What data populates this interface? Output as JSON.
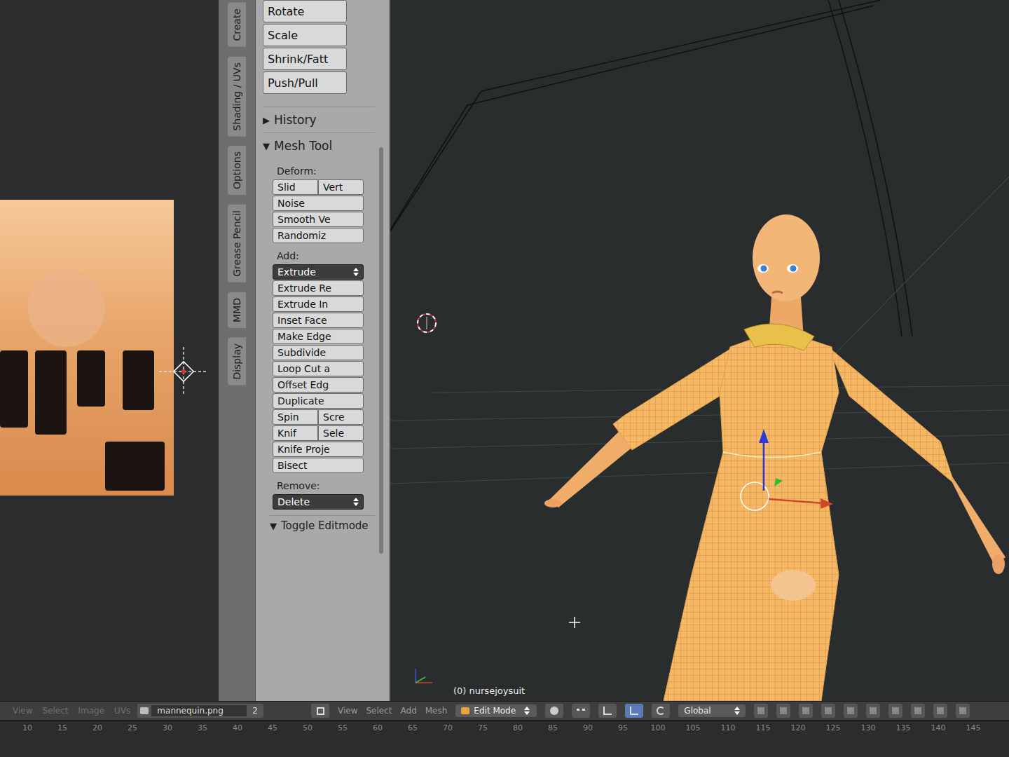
{
  "image_editor": {
    "menus": [
      "View",
      "Select",
      "Image",
      "UVs"
    ],
    "image": "mannequin.png",
    "slot": "2"
  },
  "tool_tabs": [
    {
      "label": "Create",
      "selected": false
    },
    {
      "label": "Shading / UVs",
      "selected": false
    },
    {
      "label": "Options",
      "selected": false
    },
    {
      "label": "Grease Pencil",
      "selected": false
    },
    {
      "label": "MMD",
      "selected": false
    },
    {
      "label": "Display",
      "selected": false
    }
  ],
  "tool_shelf": {
    "transform_buttons": [
      "Rotate",
      "Scale",
      "Shrink/Fatt",
      "Push/Pull"
    ],
    "panels": [
      {
        "icon": "▶",
        "label": "History",
        "expanded": false
      },
      {
        "icon": "▼",
        "label": "Mesh Tool",
        "expanded": true
      }
    ],
    "sections": [
      {
        "title": "Deform:",
        "rows": [
          [
            {
              "label": "Slid",
              "kind": "button"
            },
            {
              "label": "Vert",
              "kind": "button"
            }
          ],
          [
            {
              "label": "Noise",
              "kind": "button"
            }
          ],
          [
            {
              "label": "Smooth Ve",
              "kind": "button"
            }
          ],
          [
            {
              "label": "Randomiz",
              "kind": "button"
            }
          ]
        ]
      },
      {
        "title": "Add:",
        "rows": [
          [
            {
              "label": "Extrude",
              "kind": "dropdown"
            }
          ],
          [
            {
              "label": "Extrude Re",
              "kind": "button"
            }
          ],
          [
            {
              "label": "Extrude In",
              "kind": "button"
            }
          ],
          [
            {
              "label": "Inset Face",
              "kind": "button"
            }
          ],
          [
            {
              "label": "Make Edge",
              "kind": "button"
            }
          ],
          [
            {
              "label": "Subdivide",
              "kind": "button"
            }
          ],
          [
            {
              "label": "Loop Cut a",
              "kind": "button"
            }
          ],
          [
            {
              "label": "Offset Edg",
              "kind": "button"
            }
          ],
          [
            {
              "label": "Duplicate",
              "kind": "button"
            }
          ],
          [
            {
              "label": "Spin",
              "kind": "button"
            },
            {
              "label": "Scre",
              "kind": "button"
            }
          ],
          [
            {
              "label": "Knif",
              "kind": "button"
            },
            {
              "label": "Sele",
              "kind": "button"
            }
          ],
          [
            {
              "label": "Knife Proje",
              "kind": "button"
            }
          ],
          [
            {
              "label": "Bisect",
              "kind": "button"
            }
          ]
        ]
      },
      {
        "title": "Remove:",
        "rows": [
          [
            {
              "label": "Delete",
              "kind": "dropdown"
            }
          ]
        ]
      }
    ],
    "footer_panel": {
      "icon": "▼",
      "label": "Toggle Editmode",
      "expanded": true
    }
  },
  "viewport": {
    "object_label": "(0) nursejoysuit"
  },
  "view3d_header": {
    "menus": [
      "View",
      "Select",
      "Add",
      "Mesh"
    ],
    "mode": "Edit Mode",
    "orientation": "Global"
  },
  "timeline": {
    "ticks": [
      "10",
      "15",
      "20",
      "25",
      "30",
      "35",
      "40",
      "45",
      "50",
      "55",
      "60",
      "65",
      "70",
      "75",
      "80",
      "85",
      "90",
      "95",
      "100",
      "105",
      "110",
      "115",
      "120",
      "125",
      "130",
      "135",
      "140",
      "145"
    ]
  }
}
